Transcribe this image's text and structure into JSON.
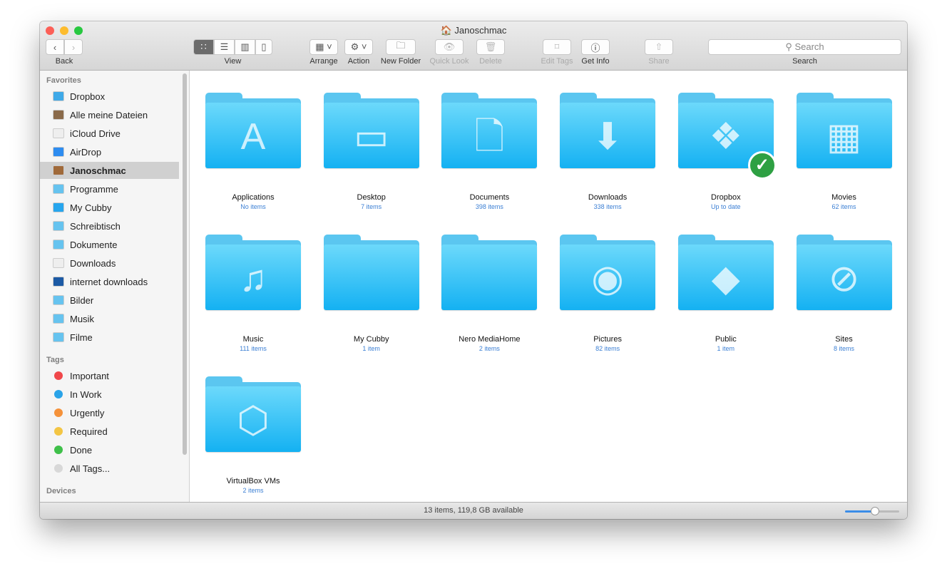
{
  "window": {
    "title": "Janoschmac"
  },
  "toolbar": {
    "back": "Back",
    "view": "View",
    "arrange": "Arrange",
    "action": "Action",
    "new_folder": "New Folder",
    "quick_look": "Quick Look",
    "delete": "Delete",
    "edit_tags": "Edit Tags",
    "get_info": "Get Info",
    "share": "Share",
    "search_placeholder": "Search",
    "search_label": "Search"
  },
  "sidebar": {
    "favorites_header": "Favorites",
    "favorites": [
      {
        "label": "Dropbox",
        "color": "#3ea9e8"
      },
      {
        "label": "Alle meine Dateien",
        "color": "#8a6a4a"
      },
      {
        "label": "iCloud Drive",
        "color": "#eeeeee"
      },
      {
        "label": "AirDrop",
        "color": "#2d8cf0"
      },
      {
        "label": "Janoschmac",
        "color": "#a06a3a"
      },
      {
        "label": "Programme",
        "color": "#66c3ef"
      },
      {
        "label": "My Cubby",
        "color": "#27a6ee"
      },
      {
        "label": "Schreibtisch",
        "color": "#66c3ef"
      },
      {
        "label": "Dokumente",
        "color": "#66c3ef"
      },
      {
        "label": "Downloads",
        "color": "#eeeeee"
      },
      {
        "label": "internet downloads",
        "color": "#1c5aa5"
      },
      {
        "label": "Bilder",
        "color": "#66c3ef"
      },
      {
        "label": "Musik",
        "color": "#66c3ef"
      },
      {
        "label": "Filme",
        "color": "#66c3ef"
      }
    ],
    "selected": "Janoschmac",
    "tags_header": "Tags",
    "tags": [
      {
        "label": "Important",
        "color": "#f0474a"
      },
      {
        "label": "In Work",
        "color": "#2aa3e8"
      },
      {
        "label": "Urgently",
        "color": "#f5923a"
      },
      {
        "label": "Required",
        "color": "#f3c544"
      },
      {
        "label": "Done",
        "color": "#3fc04a"
      },
      {
        "label": "All Tags...",
        "color": "#d8d8d8"
      }
    ],
    "devices_header": "Devices"
  },
  "items": [
    {
      "name": "Applications",
      "sub": "No items",
      "icon": "app-store-icon",
      "glyph": "A"
    },
    {
      "name": "Desktop",
      "sub": "7 items",
      "icon": "desktop-icon",
      "glyph": "▭"
    },
    {
      "name": "Documents",
      "sub": "398 items",
      "icon": "document-icon",
      "glyph": "🗋"
    },
    {
      "name": "Downloads",
      "sub": "338 items",
      "icon": "download-icon",
      "glyph": "⬇"
    },
    {
      "name": "Dropbox",
      "sub": "Up to date",
      "icon": "dropbox-icon",
      "glyph": "❖"
    },
    {
      "name": "Movies",
      "sub": "62 items",
      "icon": "film-icon",
      "glyph": "▦"
    },
    {
      "name": "Music",
      "sub": "111 items",
      "icon": "music-note-icon",
      "glyph": "♫"
    },
    {
      "name": "My Cubby",
      "sub": "1 item",
      "icon": "",
      "glyph": ""
    },
    {
      "name": "Nero MediaHome",
      "sub": "2 items",
      "icon": "",
      "glyph": ""
    },
    {
      "name": "Pictures",
      "sub": "82 items",
      "icon": "camera-icon",
      "glyph": "◉"
    },
    {
      "name": "Public",
      "sub": "1 item",
      "icon": "public-sign-icon",
      "glyph": "◆"
    },
    {
      "name": "Sites",
      "sub": "8 items",
      "icon": "compass-icon",
      "glyph": "⊘"
    },
    {
      "name": "VirtualBox VMs",
      "sub": "2 items",
      "icon": "virtualbox-icon",
      "glyph": "⬡"
    }
  ],
  "status": {
    "text": "13 items, 119,8 GB available",
    "zoom_level": 0.55
  }
}
